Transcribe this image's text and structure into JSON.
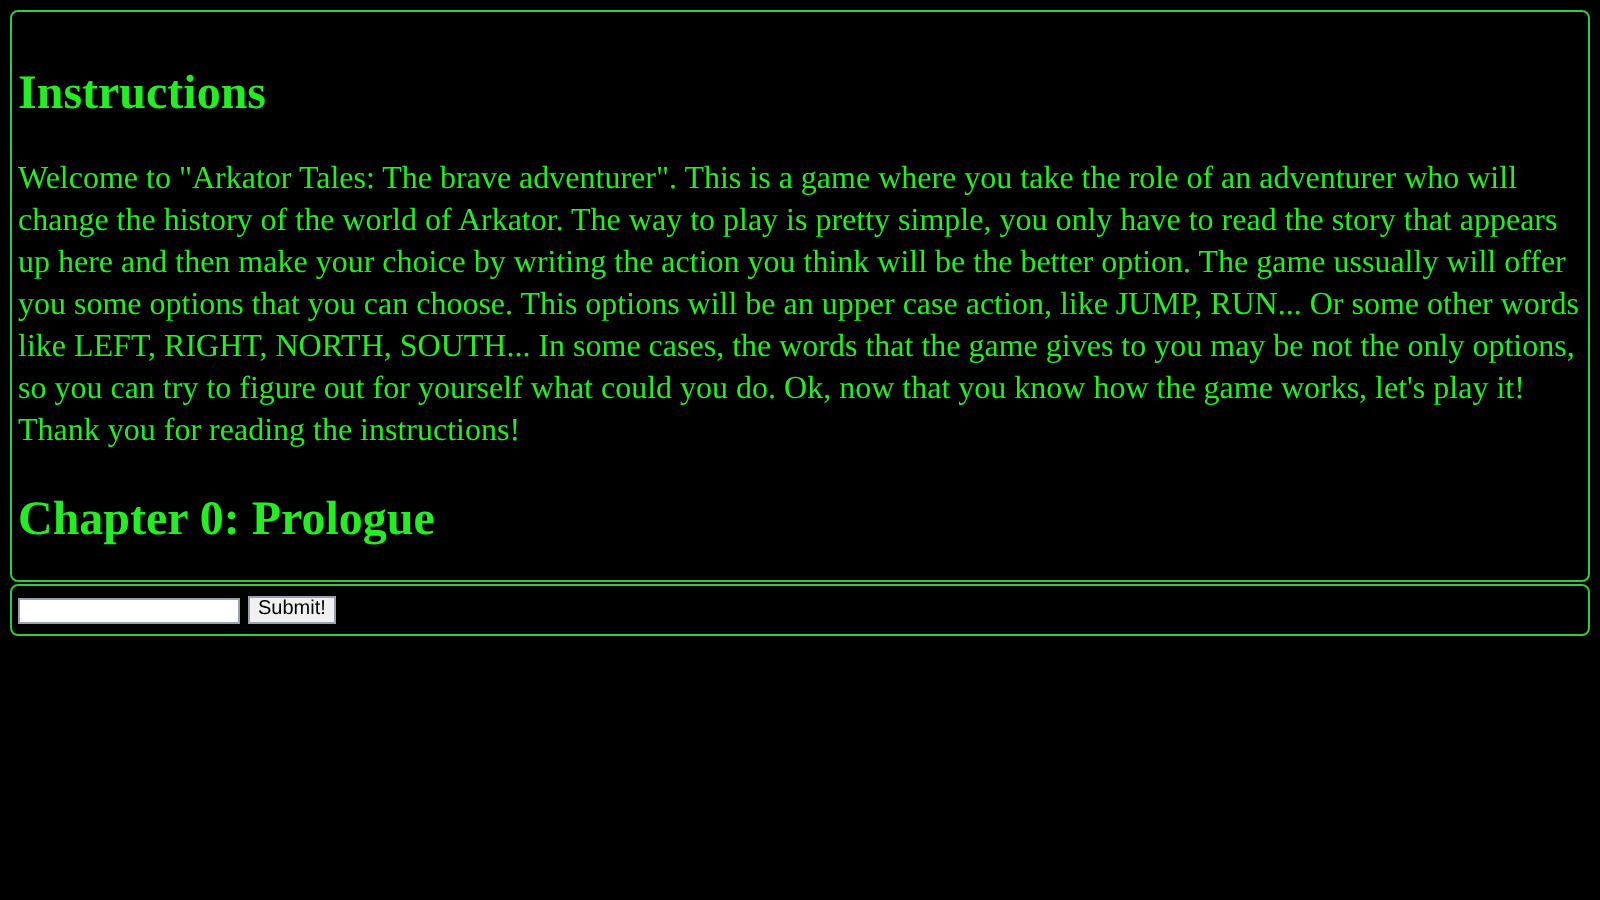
{
  "story": {
    "heading": "Instructions",
    "text": "Welcome to \"Arkator Tales: The brave adventurer\". This is a game where you take the role of an adventurer who will change the history of the world of Arkator. The way to play is pretty simple, you only have to read the story that appears up here and then make your choice by writing the action you think will be the better option. The game ussually will offer you some options that you can choose. This options will be an upper case action, like JUMP, RUN... Or some other words like LEFT, RIGHT, NORTH, SOUTH... In some cases, the words that the game gives to you may be not the only options, so you can try to figure out for yourself what could you do. Ok, now that you know how the game works, let's play it! Thank you for reading the instructions!",
    "chapter": "Chapter 0: Prologue"
  },
  "form": {
    "button": "Submit!"
  }
}
